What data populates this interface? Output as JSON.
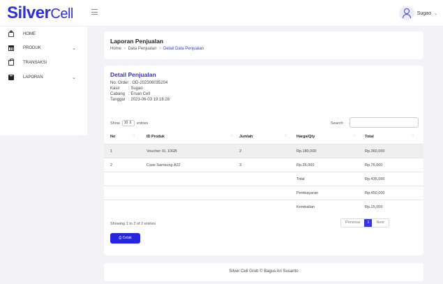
{
  "brand": {
    "part1": "Silver",
    "part2": "Cell"
  },
  "user": {
    "name": "Sugao"
  },
  "sidebar": {
    "items": [
      {
        "label": "HOME"
      },
      {
        "label": "PRODUK"
      },
      {
        "label": "TRANSAKSI"
      },
      {
        "label": "LAPORAN"
      }
    ]
  },
  "header": {
    "title": "Laporan Penjualan",
    "breadcrumb": [
      "Home",
      "Data Penjualan",
      "Detail Data Penjualan"
    ]
  },
  "detail": {
    "title": "Detail Penjualan",
    "order": "No. Order : OD-202306035204",
    "kasir_label": "Kasir",
    "kasir_value": ": Sugao",
    "cabang_label": "Cabang",
    "cabang_value": ": Ersan Cell",
    "tanggal_label": "Tanggal",
    "tanggal_value": ": 2023-06-03 19:18:28"
  },
  "controls": {
    "show": "Show",
    "entries_value": "10",
    "entries": "entries",
    "search": "Search:"
  },
  "table": {
    "headers": [
      "No",
      "ID Produk",
      "Jumlah",
      "Harga/Qty",
      "Total"
    ],
    "rows": [
      [
        "1",
        "Voucher XL 10GB",
        "2",
        "Rp.180,000",
        "Rp.360,000"
      ],
      [
        "2",
        "Case Samsung A22",
        "3",
        "Rp.25,000",
        "Rp.75,000"
      ]
    ],
    "summary": [
      {
        "label": "Total",
        "value": "Rp.435,000"
      },
      {
        "label": "Pembayaran",
        "value": "Rp.450,000"
      },
      {
        "label": "Kembalian",
        "value": "Rp.15,000"
      }
    ]
  },
  "pagination": {
    "info": "Showing 1 to 2 of 2 entries",
    "previous": "Previous",
    "current": "1",
    "next": "Next"
  },
  "actions": {
    "print": "Cetak"
  },
  "footer": {
    "text": "Silver Cell Grub © Bagus Ari Susanto"
  },
  "colors": {
    "accent": "#2525e0",
    "title": "#3535b5"
  }
}
